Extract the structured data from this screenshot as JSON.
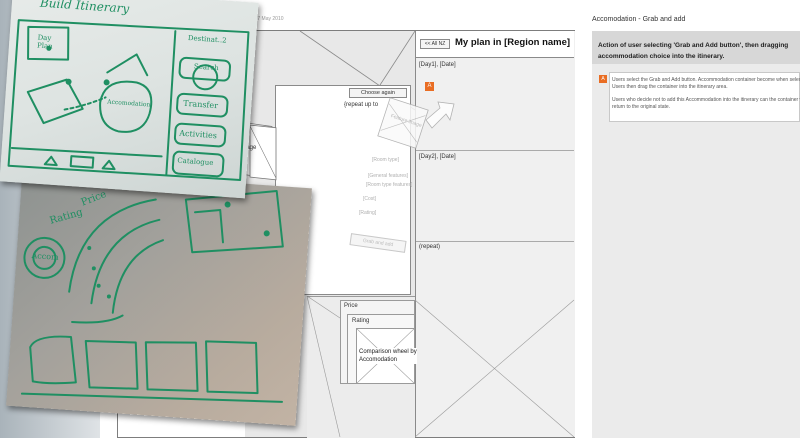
{
  "doc": {
    "title_fragment": "ing[Name] Specification | 17 May 2010"
  },
  "spec": {
    "section_title": "Accomodation - Grab and add",
    "header_text": "Action of user selecting 'Grab and Add button', then dragging accommodation choice into the itinerary.",
    "badge": "A",
    "notes": [
      "Users select the Grab and Add button. Accommodation container become when selected. Users then drag the container into the itinerary area.",
      "Users who decide not to add this Accommodation into the itinerary can the container will return to the original state."
    ]
  },
  "itinerary": {
    "back_button": "<< All NZ",
    "title": "My plan in [Region name]",
    "day1": "[Day1], [Date]",
    "day2": "[Day2], [Date]",
    "repeat": "(repeat)",
    "drag_badge": "A",
    "drag_image_label": "Feature image"
  },
  "results": {
    "choose_again": "Choose again",
    "repeat_up_to": "{repeat up to",
    "feature_image": "e image",
    "fields": [
      "[Room type]",
      "[General features]",
      "[Room type features]",
      "[Cost]",
      "[Rating]"
    ],
    "grab_button": "Grab and add",
    "filters": {
      "price": "Price",
      "rating": "Rating",
      "wheel": "Comparison wheel by Accomodation"
    }
  },
  "sketch1": {
    "title": "Build Itinerary",
    "tabs": [
      "Destinat..2",
      "Day Plan"
    ],
    "buttons": [
      "Search",
      "Transfer",
      "Activities",
      "Catalogue"
    ],
    "bubble": "Accomodation"
  },
  "sketch2": {
    "labels": [
      "Rating",
      "Price"
    ],
    "circle": "Accom"
  }
}
